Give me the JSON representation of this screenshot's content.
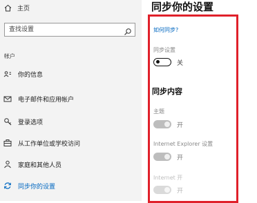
{
  "sidebar": {
    "home_label": "主页",
    "search_placeholder": "查找设置",
    "section_label": "帐户",
    "items": [
      {
        "label": "你的信息",
        "icon": "person-card-icon"
      },
      {
        "label": "电子邮件和应用帐户",
        "icon": "mail-icon"
      },
      {
        "label": "登录选项",
        "icon": "key-icon"
      },
      {
        "label": "从工作单位或学校访问",
        "icon": "briefcase-icon"
      },
      {
        "label": "家庭和其他人员",
        "icon": "person-icon"
      },
      {
        "label": "同步你的设置",
        "icon": "sync-icon"
      }
    ]
  },
  "main": {
    "title": "同步你的设置",
    "help_link": "如何同步?",
    "sync_settings_label": "同步设置",
    "sync_toggle_state": "关",
    "content_heading": "同步内容",
    "items": [
      {
        "label": "主题",
        "state": "开"
      },
      {
        "label": "Internet Explorer 设置",
        "state": "开"
      },
      {
        "label": "Internet 开",
        "state": "开"
      }
    ]
  },
  "colors": {
    "accent": "#0067c0",
    "highlight_border": "#e0202a",
    "sidebar_bg": "#f3f3f3"
  }
}
